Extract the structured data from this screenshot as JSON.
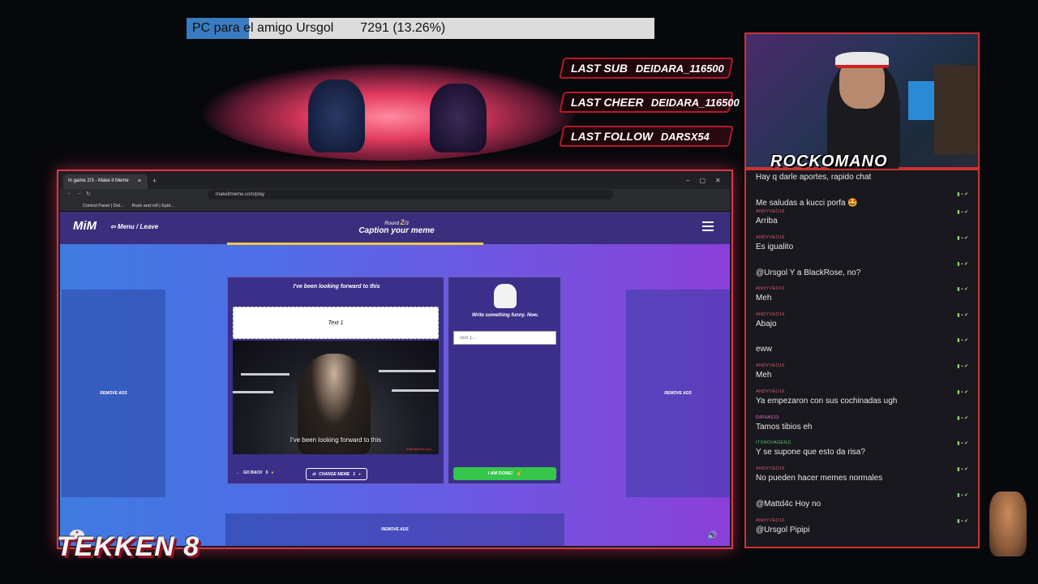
{
  "goal": {
    "label": "PC para el amigo Ursgol",
    "value": "7291 (13.26%)",
    "progress_fraction": 0.1326
  },
  "alerts": [
    {
      "key": "LAST SUB",
      "value": "DEIDARA_116500"
    },
    {
      "key": "LAST CHEER",
      "value": "DEIDARA_116500"
    },
    {
      "key": "LAST FOLLOW",
      "value": "DARSX54"
    }
  ],
  "cam": {
    "name": "ROCKOMANO"
  },
  "browser": {
    "tab_title": "In game 2/3 - Make it Meme",
    "tab_close": "×",
    "new_tab": "+",
    "window_controls": [
      "–",
      "▢",
      "✕"
    ],
    "url": "makeitmeme.com/play",
    "nav": {
      "back": "←",
      "forward": "→",
      "reload": "↻"
    },
    "bookmarks": [
      "Control Panel | Del...",
      "Rock and roll | Epid..."
    ]
  },
  "page": {
    "logo": "MiM",
    "menu": "⇦ Menu / Leave",
    "round_prefix": "Round ",
    "round_num": "2",
    "round_total": "/3",
    "caption": "Caption your meme",
    "ad_label": "REMOVE ADS",
    "meme": {
      "title": "I've been looking forward to this",
      "text_placeholder": "Text 1",
      "image_caption": "I've been looking forward to this",
      "watermark": "makeitmeme.com",
      "go_back": "GO BACK",
      "go_back_cost": "5",
      "change": "CHANGE MEME",
      "change_cost": "1"
    },
    "side": {
      "prompt": "Write something funny. Now.",
      "input_placeholder": "Text 1...",
      "done": "I AM DONE!"
    }
  },
  "tekken": "TEKKEN 8",
  "chat": [
    {
      "user": "",
      "text": "Hay q darle aportes, rapido chat",
      "color": "#9b8fbf"
    },
    {
      "user": "",
      "text": "Me saludas a kucci porfa 🤩",
      "color": "#9b8fbf"
    },
    {
      "user": "ANDYVEO16",
      "text": "Arriba",
      "color": "#e05a6a"
    },
    {
      "user": "ANDYVEO16",
      "text": "Es igualito",
      "color": "#e05a6a"
    },
    {
      "user": "",
      "text": "@Ursgol Y a BlackRose, no?",
      "color": "#6bbf4a"
    },
    {
      "user": "ANDYVEO16",
      "text": "Meh",
      "color": "#e05a6a"
    },
    {
      "user": "ANDYVEO16",
      "text": "Abajo",
      "color": "#e05a6a"
    },
    {
      "user": "",
      "text": "eww",
      "color": "#6b7bdf"
    },
    {
      "user": "ANDYVEO16",
      "text": "Meh",
      "color": "#e05a6a"
    },
    {
      "user": "ANDYVEO16",
      "text": "Ya empezaron con sus cochinadas ugh",
      "color": "#e05a6a"
    },
    {
      "user": "DIRVAS13",
      "text": "Tamos tibios eh",
      "color": "#e07acb"
    },
    {
      "user": "ITSNOVAGENJI",
      "text": "Y se supone que esto da risa?",
      "color": "#5ac86a"
    },
    {
      "user": "ANDYVEO16",
      "text": "No pueden hacer memes normales",
      "color": "#e05a6a"
    },
    {
      "user": "",
      "text": "@Mattd4c Hoy no",
      "color": "#6b7bdf"
    },
    {
      "user": "ANDYVEO16",
      "text": "@Ursgol Pipipi",
      "color": "#e05a6a"
    }
  ]
}
